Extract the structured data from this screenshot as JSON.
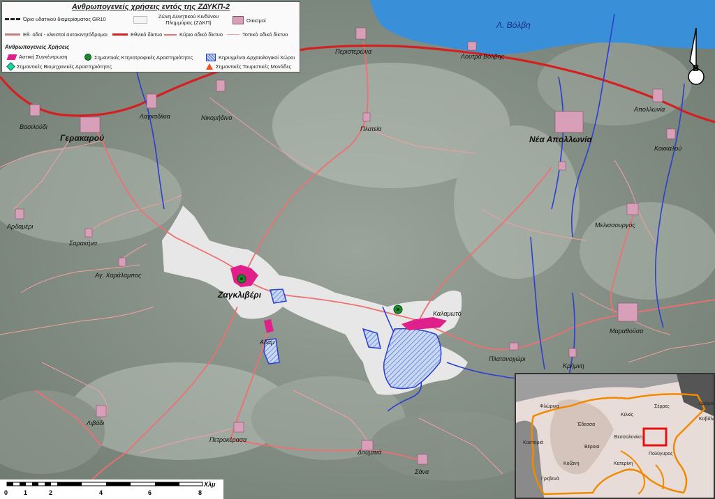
{
  "legend": {
    "title": "Ανθρωπογενείς χρήσεις εντός της ΖΔΥΚΠ-2",
    "boundary": "Όριο υδατικού διαμερίσματος GR10",
    "flood_zone": "Ζώνη Δυνητικού Κινδύνου Πλημμύρας (ΖΔΚΠ)",
    "settlements": "Οικισμοί",
    "motorways": "Εθ. οδοί - κλειστοί αυτοκινητόδρομοι",
    "national": "Εθνικό δίκτυο",
    "main_road": "Κύριο οδικό δίκτυο",
    "local_road": "Τοπικό οδικό δίκτυο",
    "human_uses": "Ανθρωπογενείς Χρήσεις",
    "urban": "Αστική Συγκέντρωση",
    "livestock": "Σημαντικές Κτηνοτροφικές Δραστηριότητες",
    "archaeo": "Κηρυγμένοι Αρχαιολογικοί Χώροι",
    "industrial": "Σημαντικές Βιομηχανικές Δραστηριότητες",
    "tourism": "Σημαντικές Τουριστικές Μονάδες"
  },
  "places": {
    "volvi": "Λ. Βόλβη",
    "peristerona": "Περιστερώνα",
    "loutra": "Λουτρά Βόλβης",
    "apollonia": "Απολλωνία",
    "vasiloudi": "Βασιλούδι",
    "gerakarou": "Γερακαρού",
    "lagkadikia": "Λαγκαδίκια",
    "nikomidino": "Νικομήδινο",
    "plateia": "Πλατεία",
    "nea_apollonia": "Νέα Απολλωνία",
    "kokkalou": "Κοκκαλού",
    "ardameri": "Αρδαμέρι",
    "sarakina": "Σαρακήνα",
    "ag_charalampos": "Αγ. Χαράλαμπος",
    "melissourgos": "Μελισσουργός",
    "zagkliveri": "Ζαγκλιβέρι",
    "kalamoto": "Καλαμωτό",
    "adam": "Αδάμ",
    "platanochori": "Πλατανοχώρι",
    "marathousa": "Μαραθούσα",
    "krimni": "Κρήμνη",
    "livadi": "Λιβάδι",
    "petrokerasa": "Πετροκέρασα",
    "doumpia": "Δουμπιά",
    "sana": "Σάνα"
  },
  "inset": {
    "florina": "Φλώρινα",
    "edessa": "Έδεσσα",
    "kilkis": "Κιλκίς",
    "serres": "Σέρρες",
    "drama": "Δράμα",
    "kavala": "Καβάλα",
    "kastoria": "Καστοριά",
    "veroia": "Βέροια",
    "thessaloniki": "Θεσσαλονίκη",
    "kozani": "Κοζάνη",
    "katerini": "Κατερίνη",
    "poligyros": "Πολύγυρος",
    "grevena": "Γρεβενά"
  },
  "scale": {
    "ticks": [
      "0",
      "1",
      "2",
      "4",
      "6",
      "8"
    ],
    "unit": "Χλμ"
  },
  "north": {
    "label": "Β"
  },
  "colors": {
    "national_road": "#d42020",
    "main_road": "#f08080",
    "river": "#2a3fd0",
    "lake": "#3a90d8",
    "urban": "#e0208a",
    "settlement": "#d8a0b8",
    "flood": "#eeeeee"
  }
}
